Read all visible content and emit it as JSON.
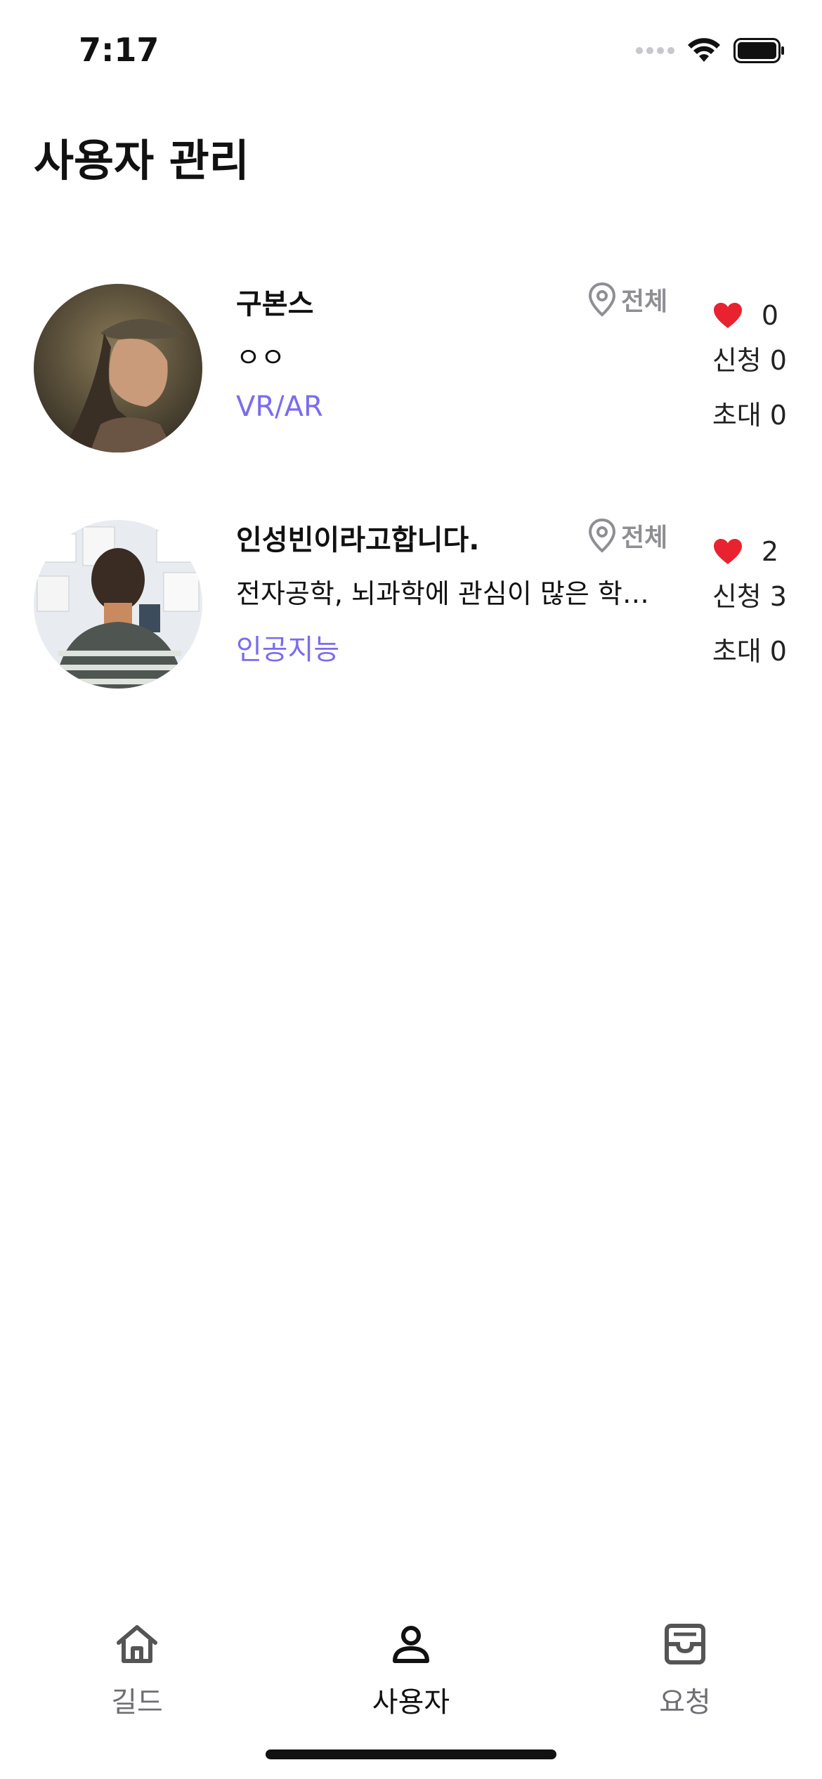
{
  "status_bar": {
    "time": "7:17"
  },
  "header": {
    "title": "사용자 관리"
  },
  "users": [
    {
      "name": "구본스",
      "description": "ㅇㅇ",
      "tag": "VR/AR",
      "region": "전체",
      "likes": "0",
      "applications": "신청 0",
      "invitations": "초대 0"
    },
    {
      "name": "인성빈이라고합니다.",
      "description": "전자공학, 뇌과학에 관심이 많은 학생입니다.",
      "tag": "인공지능",
      "region": "전체",
      "likes": "2",
      "applications": "신청 3",
      "invitations": "초대 0"
    }
  ],
  "tab_bar": {
    "tabs": [
      {
        "label": "길드",
        "icon": "home-icon"
      },
      {
        "label": "사용자",
        "icon": "user-icon"
      },
      {
        "label": "요청",
        "icon": "inbox-icon"
      }
    ],
    "active_index": 1
  },
  "colors": {
    "accent_tag": "#7a6cf0",
    "region_gray": "#8e8e93",
    "heart": "#e8232f"
  }
}
